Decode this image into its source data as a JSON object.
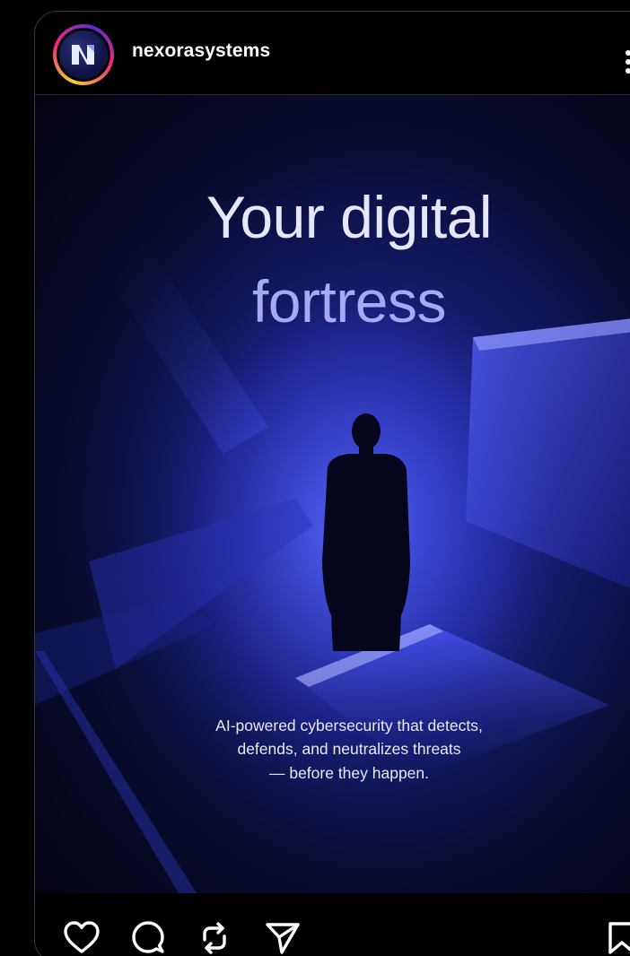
{
  "post": {
    "username": "nexorasystems",
    "avatar_icon": "nexora-logo-icon",
    "more_icon": "more-options-icon",
    "headline_line1": "Your digital",
    "headline_line2": "fortress",
    "subtext_line1": "AI-powered cybersecurity that detects,",
    "subtext_line2": "defends, and neutralizes threats",
    "subtext_line3": "— before they happen."
  },
  "actions": {
    "like_icon": "heart-icon",
    "comment_icon": "comment-icon",
    "repost_icon": "repost-icon",
    "share_icon": "send-icon",
    "save_icon": "bookmark-icon"
  },
  "colors": {
    "avatar_ring": "#ee2a7b",
    "headline_primary": "#e6e7ff",
    "headline_accent": "#a7a9f5",
    "glow": "#3a45d8"
  }
}
